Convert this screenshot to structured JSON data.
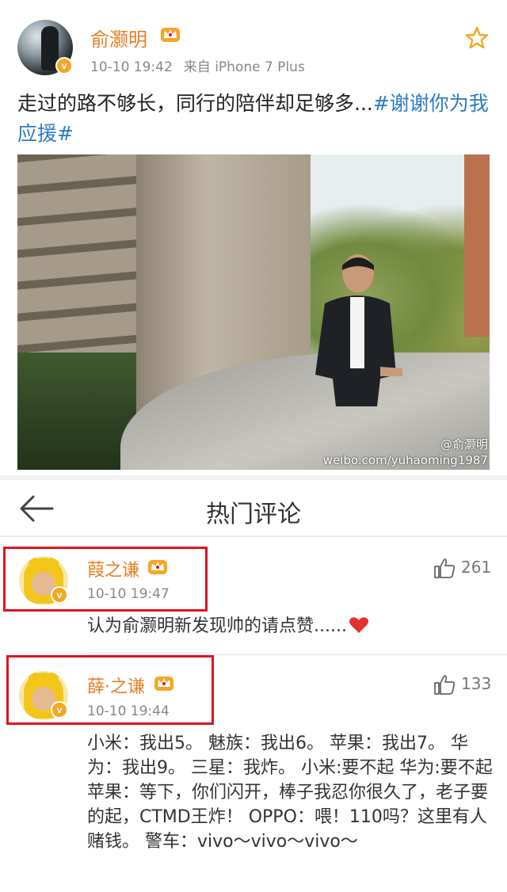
{
  "post": {
    "author": "俞灏明",
    "time": "10-10 19:42",
    "source": "来自 iPhone 7 Plus",
    "text": "走过的路不够长，同行的陪伴却足够多...",
    "hashtag": "#谢谢你为我应援#",
    "photo_watermark_handle": "@俞灏明",
    "photo_watermark_url": "weibo.com/yuhaoming1987",
    "icons": {
      "favorite": "star-icon",
      "verified": "verified-badge-icon",
      "membership": "crown-icon"
    }
  },
  "header": {
    "title": "热门评论",
    "back_icon": "back-arrow-icon"
  },
  "comments": [
    {
      "author": "葭之谦",
      "time": "10-10 19:47",
      "likes": "261",
      "text": "认为俞灏明新发现帅的请点赞......",
      "trailing_icon": "heart-icon"
    },
    {
      "author": "薛·之谦",
      "time": "10-10 19:44",
      "likes": "133",
      "text": "小米：我出5。 魅族：我出6。 苹果：我出7。 华为：我出9。 三星：我炸。 小米:要不起 华为:要不起 苹果：等下，你们闪开，棒子我忍你很久了，老子要的起，CTMD王炸！ OPPO：喂！110吗？这里有人赌钱。 警车：vivo～vivo～vivo～"
    }
  ],
  "colors": {
    "author_name": "#e67e22",
    "hashtag": "#2e7bc4",
    "verified_badge": "#f5a623",
    "highlight_box": "#e0141e",
    "heart": "#e5302b"
  }
}
